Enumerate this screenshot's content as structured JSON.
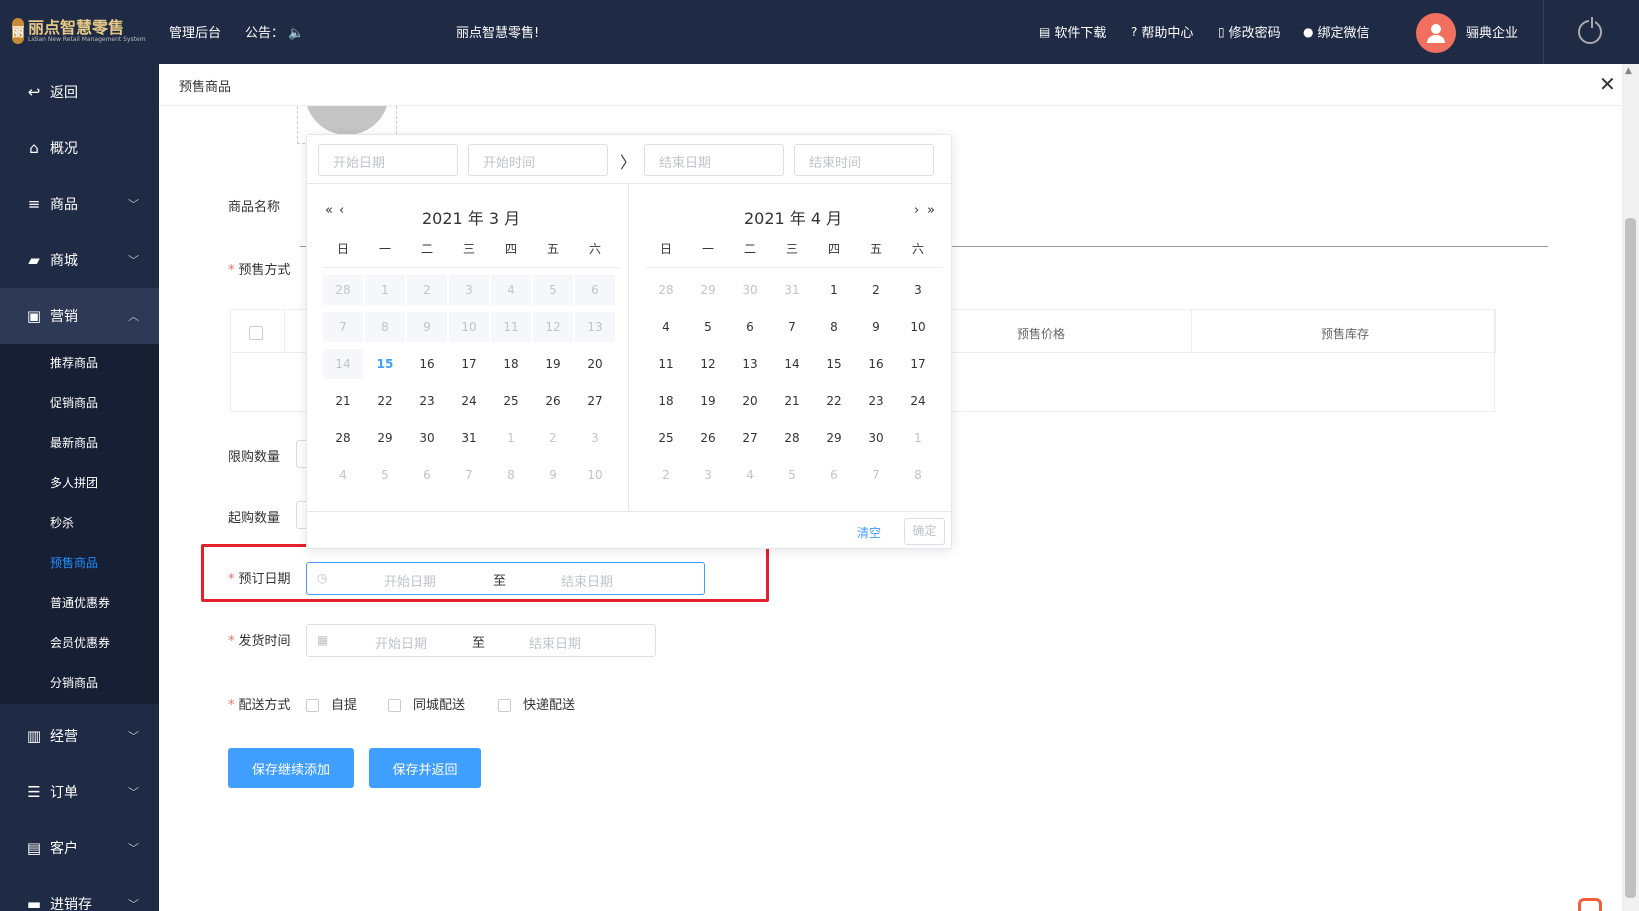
{
  "header": {
    "logo_mark": "丽",
    "logo_title": "丽点智慧零售",
    "logo_sub": "Lidian New Retail Management System",
    "admin": "管理后台",
    "notice": "公告：",
    "marquee": "丽点智慧零售!",
    "links": [
      "软件下载",
      "帮助中心",
      "修改密码",
      "绑定微信"
    ],
    "company": "骊典企业"
  },
  "sidebar": {
    "back": "返回",
    "items": [
      "概况",
      "商品",
      "商城",
      "营销",
      "经营",
      "订单",
      "客户",
      "进销存"
    ],
    "sub": [
      "推荐商品",
      "促销商品",
      "最新商品",
      "多人拼团",
      "秒杀",
      "预售商品",
      "普通优惠券",
      "会员优惠券",
      "分销商品"
    ]
  },
  "page": {
    "title": "预售商品"
  },
  "form": {
    "name_label": "商品名称",
    "mode_label": "预售方式",
    "columns": [
      "预售价格",
      "预售库存"
    ],
    "limit_label": "限购数量",
    "min_label": "起购数量",
    "order_label": "预订日期",
    "ship_label": "发货时间",
    "delivery_label": "配送方式",
    "start_date": "开始日期",
    "end_date": "结束日期",
    "sep": "至",
    "delivery_options": [
      "自提",
      "同城配送",
      "快递配送"
    ],
    "btn_continue": "保存继续添加",
    "btn_return": "保存并返回"
  },
  "picker": {
    "start_date": "开始日期",
    "start_time": "开始时间",
    "end_date": "结束日期",
    "end_time": "结束时间",
    "left_month": "2021 年 3 月",
    "right_month": "2021 年 4 月",
    "weekdays": [
      "日",
      "一",
      "二",
      "三",
      "四",
      "五",
      "六"
    ],
    "clear": "清空",
    "ok": "确定",
    "left_days": [
      "28",
      "1",
      "2",
      "3",
      "4",
      "5",
      "6",
      "7",
      "8",
      "9",
      "10",
      "11",
      "12",
      "13",
      "14",
      "15",
      "16",
      "17",
      "18",
      "19",
      "20",
      "21",
      "22",
      "23",
      "24",
      "25",
      "26",
      "27",
      "28",
      "29",
      "30",
      "31",
      "1",
      "2",
      "3",
      "4",
      "5",
      "6",
      "7",
      "8",
      "9",
      "10"
    ],
    "right_days": [
      "28",
      "29",
      "30",
      "31",
      "1",
      "2",
      "3",
      "4",
      "5",
      "6",
      "7",
      "8",
      "9",
      "10",
      "11",
      "12",
      "13",
      "14",
      "15",
      "16",
      "17",
      "18",
      "19",
      "20",
      "21",
      "22",
      "23",
      "24",
      "25",
      "26",
      "27",
      "28",
      "29",
      "30",
      "1",
      "2",
      "3",
      "4",
      "5",
      "6",
      "7",
      "8"
    ]
  }
}
